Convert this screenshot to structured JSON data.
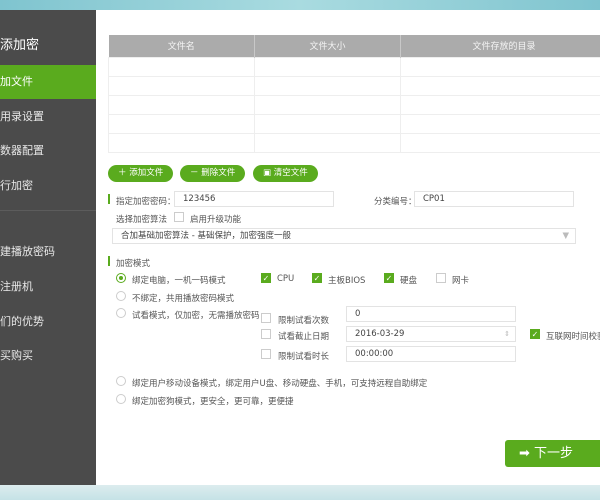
{
  "sidebar": {
    "title": "添加密",
    "items": [
      {
        "label": "加文件",
        "active": true
      },
      {
        "label": "用录设置"
      },
      {
        "label": "数器配置"
      },
      {
        "label": "行加密"
      },
      {
        "label": "建播放密码"
      },
      {
        "label": "注册机"
      },
      {
        "label": "们的优势"
      },
      {
        "label": "买购买"
      }
    ]
  },
  "table": {
    "headers": [
      "文件名",
      "文件大小",
      "文件存放的目录"
    ],
    "rows": 5
  },
  "buttons": {
    "add": "添加文件",
    "remove": "删除文件",
    "clear": "清空文件",
    "next": "下一步"
  },
  "form": {
    "password_label": "指定加密密码：",
    "password_value": "123456",
    "category_label": "分类编号：",
    "category_value": "CP01",
    "algo_label": "选择加密算法",
    "upgrade_label": "启用升级功能",
    "algo_value": "合加基础加密算法 - 基础保护，加密强度一般",
    "mode_label": "加密模式",
    "modes": [
      "绑定电脑，一机一码模式",
      "不绑定，共用播放密码模式",
      "试看模式，仅加密，无需播放密码",
      "绑定用户移动设备模式，绑定用户U盘、移动硬盘、手机，可支持远程自助绑定",
      "绑定加密狗模式，更安全，更可靠，更便捷"
    ],
    "hardware": [
      {
        "label": "CPU",
        "checked": true
      },
      {
        "label": "主板BIOS",
        "checked": true
      },
      {
        "label": "硬盘",
        "checked": true
      },
      {
        "label": "网卡",
        "checked": false
      }
    ],
    "trial": [
      {
        "label": "限制试看次数",
        "value": "0"
      },
      {
        "label": "试看截止日期",
        "value": "2016-03-29"
      },
      {
        "label": "限制试看时长",
        "value": "00:00:00"
      }
    ],
    "net_check": "互联网时间校验"
  },
  "colors": {
    "accent": "#5aab1e",
    "sidebar": "#4b4b4b"
  }
}
